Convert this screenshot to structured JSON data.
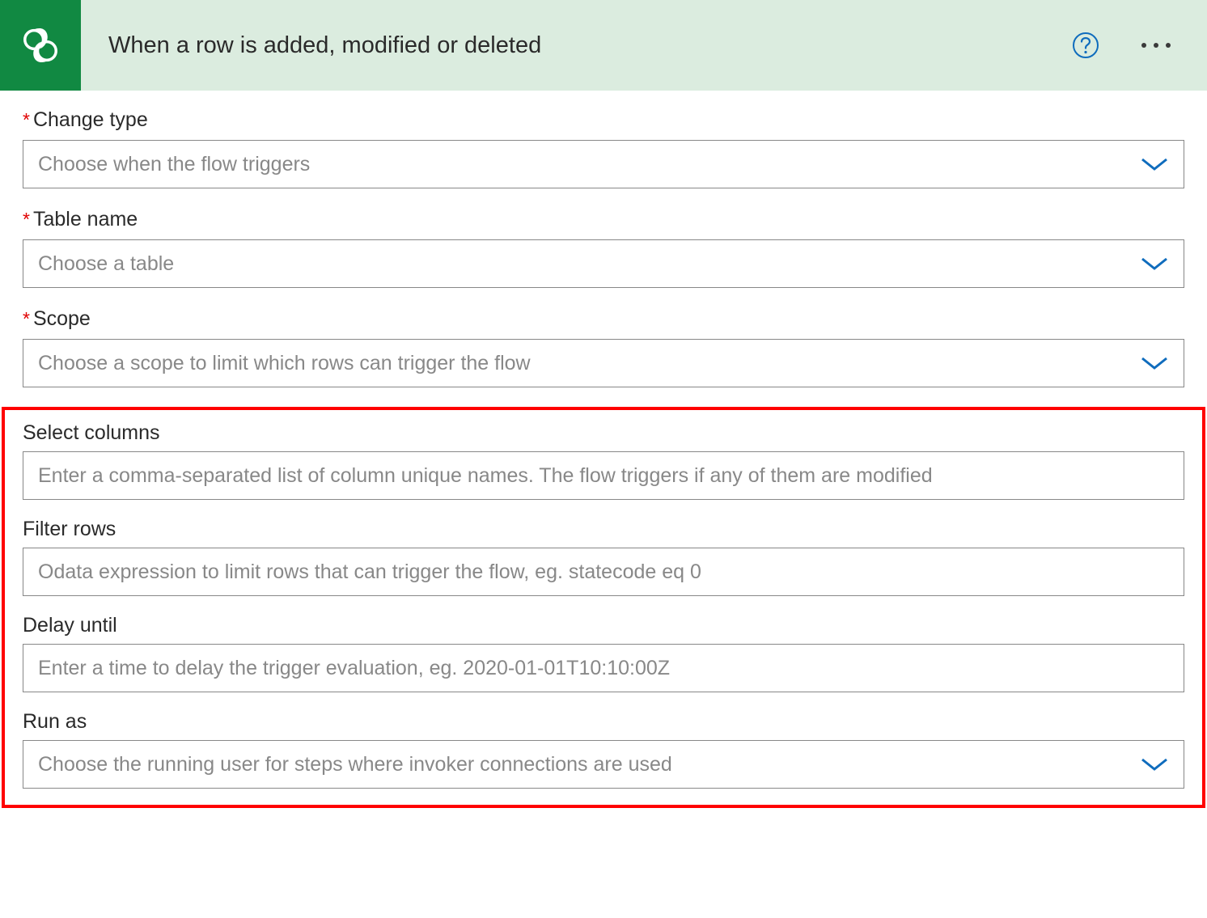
{
  "header": {
    "title": "When a row is added, modified or deleted"
  },
  "fields": {
    "change_type": {
      "label": "Change type",
      "required": true,
      "placeholder": "Choose when the flow triggers"
    },
    "table_name": {
      "label": "Table name",
      "required": true,
      "placeholder": "Choose a table"
    },
    "scope": {
      "label": "Scope",
      "required": true,
      "placeholder": "Choose a scope to limit which rows can trigger the flow"
    },
    "select_columns": {
      "label": "Select columns",
      "required": false,
      "placeholder": "Enter a comma-separated list of column unique names. The flow triggers if any of them are modified"
    },
    "filter_rows": {
      "label": "Filter rows",
      "required": false,
      "placeholder": "Odata expression to limit rows that can trigger the flow, eg. statecode eq 0"
    },
    "delay_until": {
      "label": "Delay until",
      "required": false,
      "placeholder": "Enter a time to delay the trigger evaluation, eg. 2020-01-01T10:10:00Z"
    },
    "run_as": {
      "label": "Run as",
      "required": false,
      "placeholder": "Choose the running user for steps where invoker connections are used"
    }
  }
}
